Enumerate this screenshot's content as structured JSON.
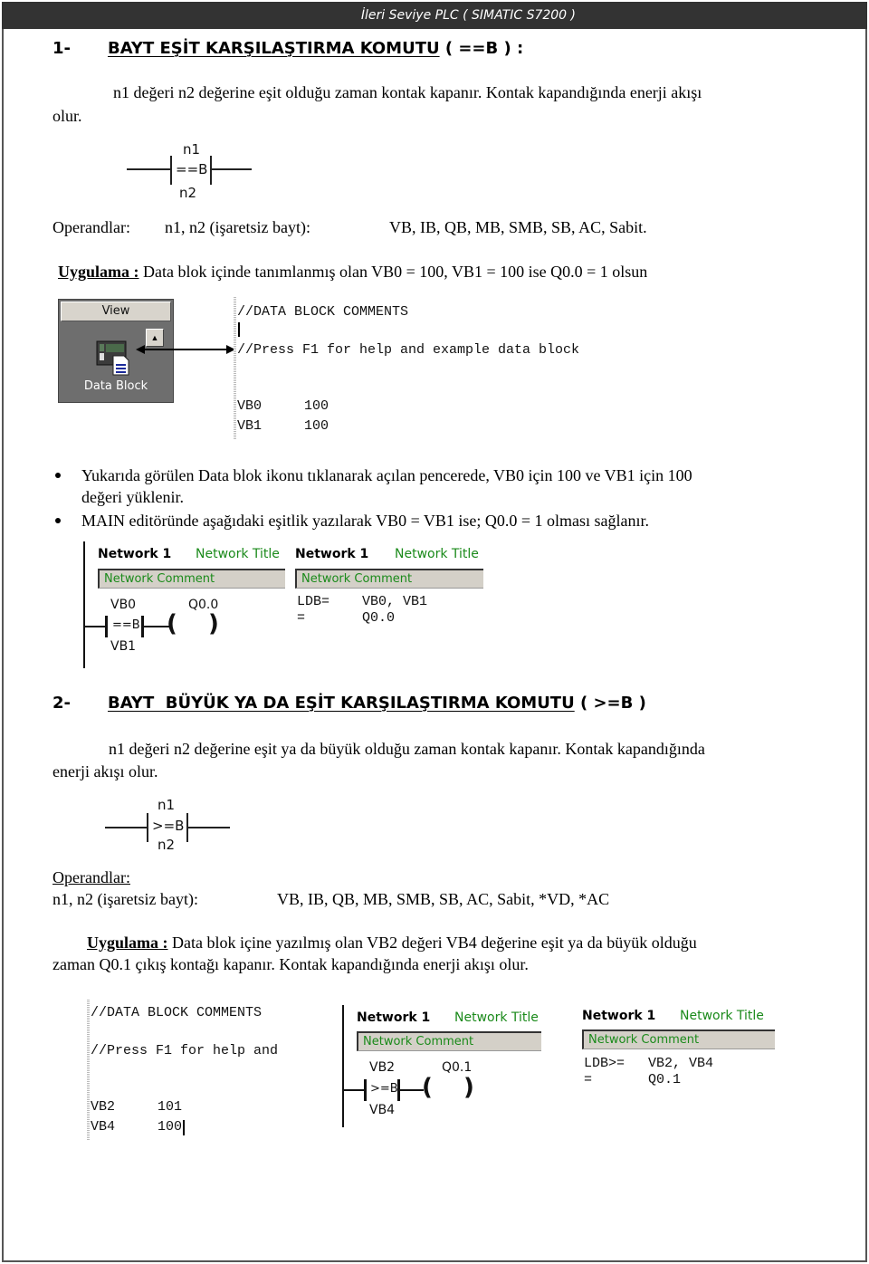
{
  "header": {
    "title": "İleri Seviye PLC ( SIMATIC S7200 )"
  },
  "section1": {
    "number": "1-",
    "title_underlined": "BAYT EŞİT KARŞILAŞTIRMA KOMUTU",
    "title_suffix": " ( ==B ) :",
    "description_line1": "n1 değeri n2 değerine eşit olduğu zaman kontak kapanır. Kontak kapandığında enerji akışı",
    "description_line2": "olur.",
    "symbol": {
      "top": "n1",
      "op": "==B",
      "bottom": "n2"
    },
    "operands_label": "Operandlar:",
    "operands_type": "n1, n2 (işaretsiz bayt):",
    "operands_list": "VB, IB, QB, MB, SMB, SB, AC, Sabit.",
    "application_label": "Uygulama :",
    "application_text": "Data blok içinde tanımlanmış olan VB0 = 100, VB1 = 100 ise Q0.0 = 1 olsun",
    "view_panel": {
      "button_label": "View",
      "icon_label": "Data Block",
      "scroll_icon": "▲"
    },
    "data_block": {
      "comment1": "//DATA BLOCK COMMENTS",
      "comment2": "//Press F1 for help and example data block",
      "rows": [
        {
          "name": "VB0",
          "value": "100"
        },
        {
          "name": "VB1",
          "value": "100"
        }
      ]
    },
    "bullets": [
      "Yukarıda görülen Data blok ikonu tıklanarak açılan pencerede, VB0 için 100 ve VB1 için 100",
      "değeri yüklenir.",
      "MAIN editöründe aşağıdaki eşitlik yazılarak VB0 = VB1 ise; Q0.0 = 1 olması sağlanır."
    ],
    "ladder": {
      "network": "Network 1",
      "network_title": "Network Title",
      "comment": "Network Comment",
      "top": "VB0",
      "op": "==B",
      "bottom": "VB1",
      "coil": "Q0.0"
    },
    "stl": {
      "network": "Network 1",
      "network_title": "Network Title",
      "comment": "Network Comment",
      "line1_op": "LDB=",
      "line1_args": "VB0, VB1",
      "line2_op": "=",
      "line2_args": "Q0.0"
    }
  },
  "section2": {
    "number": "2-",
    "title_underlined": "BAYT  BÜYÜK YA DA EŞİT KARŞILAŞTIRMA KOMUTU",
    "title_suffix": " ( >=B )",
    "description_line1": "n1 değeri n2 değerine eşit ya da büyük olduğu zaman kontak kapanır. Kontak kapandığında",
    "description_line2": "enerji akışı olur.",
    "symbol": {
      "top": "n1",
      "op": ">=B",
      "bottom": "n2"
    },
    "operands_label": "Operandlar:",
    "operands_type": "n1, n2 (işaretsiz bayt):",
    "operands_list": "VB, IB, QB, MB, SMB, SB, AC, Sabit, *VD, *AC",
    "application_label": "Uygulama :",
    "application_line1": " Data blok içine yazılmış olan VB2 değeri VB4 değerine eşit ya da büyük olduğu",
    "application_line2": "zaman Q0.1 çıkış kontağı kapanır. Kontak kapandığında enerji akışı olur.",
    "data_block": {
      "comment1": "//DATA BLOCK COMMENTS",
      "comment2": "//Press F1 for help and",
      "rows": [
        {
          "name": "VB2",
          "value": "101"
        },
        {
          "name": "VB4",
          "value": "100"
        }
      ]
    },
    "ladder": {
      "network": "Network 1",
      "network_title": "Network Title",
      "comment": "Network Comment",
      "top": "VB2",
      "op": ">=B",
      "bottom": "VB4",
      "coil": "Q0.1"
    },
    "stl": {
      "network": "Network 1",
      "network_title": "Network Title",
      "comment": "Network Comment",
      "line1_op": "LDB>=",
      "line1_args": "VB2, VB4",
      "line2_op": "=",
      "line2_args": "Q0.1"
    }
  }
}
